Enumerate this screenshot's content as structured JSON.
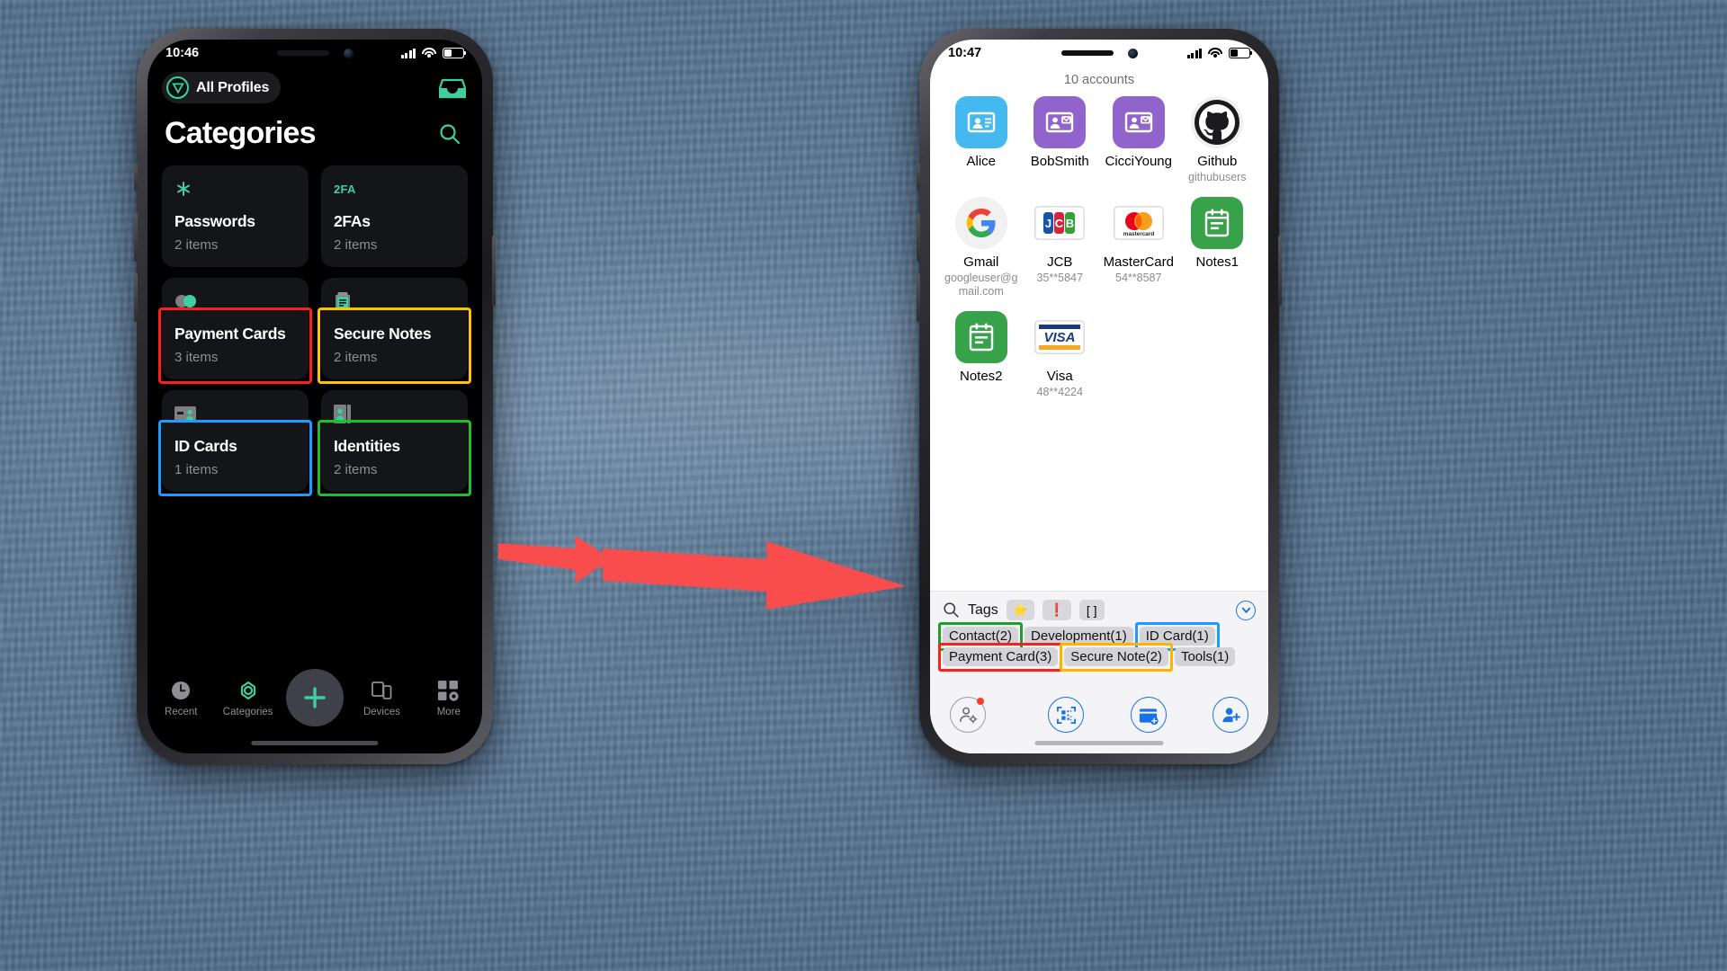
{
  "accent": {
    "teal": "#3ecfa0",
    "blue": "#1573e6",
    "dark_card": "#141518"
  },
  "left_phone": {
    "status": {
      "time": "10:46",
      "signal_icon": "cellular-bars-icon",
      "wifi_icon": "wifi-icon",
      "battery_icon": "battery-icon"
    },
    "profile_chip": {
      "label": "All Profiles",
      "logo_icon": "vault-shield-icon"
    },
    "inbox_icon": "inbox-tray-icon",
    "page_title": "Categories",
    "search_icon": "search-icon",
    "categories": [
      {
        "name": "Passwords",
        "count": "2 items",
        "icon": "asterisk-icon",
        "highlight": "none"
      },
      {
        "name": "2FAs",
        "count": "2 items",
        "icon": "2fa-text-icon",
        "highlight": "none"
      },
      {
        "name": "Payment Cards",
        "count": "3 items",
        "icon": "toggle-coins-icon",
        "highlight": "#ff1e1e"
      },
      {
        "name": "Secure Notes",
        "count": "2 items",
        "icon": "note-clip-icon",
        "highlight": "#ffc400"
      },
      {
        "name": "ID Cards",
        "count": "1 items",
        "icon": "id-card-icon",
        "highlight": "#1e9bff"
      },
      {
        "name": "Identities",
        "count": "2 items",
        "icon": "identity-book-icon",
        "highlight": "#19c229"
      }
    ],
    "tabs": [
      {
        "label": "Recent",
        "icon": "clock-icon"
      },
      {
        "label": "Categories",
        "icon": "categories-icon"
      },
      {
        "label": "",
        "icon": "plus-icon"
      },
      {
        "label": "Devices",
        "icon": "devices-icon"
      },
      {
        "label": "More",
        "icon": "more-grid-icon"
      }
    ]
  },
  "right_phone": {
    "status": {
      "time": "10:47",
      "signal_icon": "cellular-bars-icon",
      "wifi_icon": "wifi-icon",
      "battery_icon": "battery-icon"
    },
    "accounts_count": "10 accounts",
    "accounts": [
      {
        "name": "Alice",
        "sub": "",
        "icon": "contact-card-icon",
        "bg": "#43b9ef"
      },
      {
        "name": "BobSmith",
        "sub": "",
        "icon": "contact-mail-icon",
        "bg": "#9063cd"
      },
      {
        "name": "CicciYoung",
        "sub": "",
        "icon": "contact-mail-icon",
        "bg": "#9063cd"
      },
      {
        "name": "Github",
        "sub": "githubusers",
        "icon": "github-icon",
        "bg": "#f0f0f0"
      },
      {
        "name": "Gmail",
        "sub": "googleuser@gmail.com",
        "icon": "google-icon",
        "bg": "#f0f0f0"
      },
      {
        "name": "JCB",
        "sub": "35**5847",
        "icon": "jcb-card-icon",
        "bg": "#ffffff"
      },
      {
        "name": "MasterCard",
        "sub": "54**8587",
        "icon": "mastercard-icon",
        "bg": "#ffffff"
      },
      {
        "name": "Notes1",
        "sub": "",
        "icon": "note-green-icon",
        "bg": "#37a24a"
      },
      {
        "name": "Notes2",
        "sub": "",
        "icon": "note-green-icon",
        "bg": "#37a24a"
      },
      {
        "name": "Visa",
        "sub": "48**4224",
        "icon": "visa-card-icon",
        "bg": "#ffffff"
      }
    ],
    "tags_panel": {
      "search_icon": "search-icon",
      "title": "Tags",
      "quick_filters": [
        {
          "label": "⭐",
          "name": "favorite-filter"
        },
        {
          "label": "❗",
          "name": "important-filter"
        },
        {
          "label": "[ ]",
          "name": "bracket-filter"
        }
      ],
      "collapse_icon": "chevron-down-circle-icon",
      "tags": [
        {
          "label": "Contact(2)",
          "highlight": "#19a12a"
        },
        {
          "label": "Development(1)",
          "highlight": "none"
        },
        {
          "label": "ID Card(1)",
          "highlight": "#1e9bff"
        },
        {
          "label": "Payment Card(3)",
          "highlight": "#ff1e1e"
        },
        {
          "label": "Secure Note(2)",
          "highlight": "#ffb300"
        },
        {
          "label": "Tools(1)",
          "highlight": "none"
        }
      ]
    },
    "bottom_bar": [
      {
        "icon": "user-settings-icon",
        "name": "account-settings-button",
        "style": "grey",
        "badge": true
      },
      {
        "icon": "qr-scan-icon",
        "name": "scan-qr-button",
        "style": "blue",
        "badge": false
      },
      {
        "icon": "add-card-icon",
        "name": "add-card-button",
        "style": "blue",
        "badge": false
      },
      {
        "icon": "add-user-icon",
        "name": "add-user-button",
        "style": "blue",
        "badge": false
      }
    ]
  },
  "annotation": {
    "arrow_color": "#f94d4d",
    "arrow_name": "red-flow-arrow"
  }
}
